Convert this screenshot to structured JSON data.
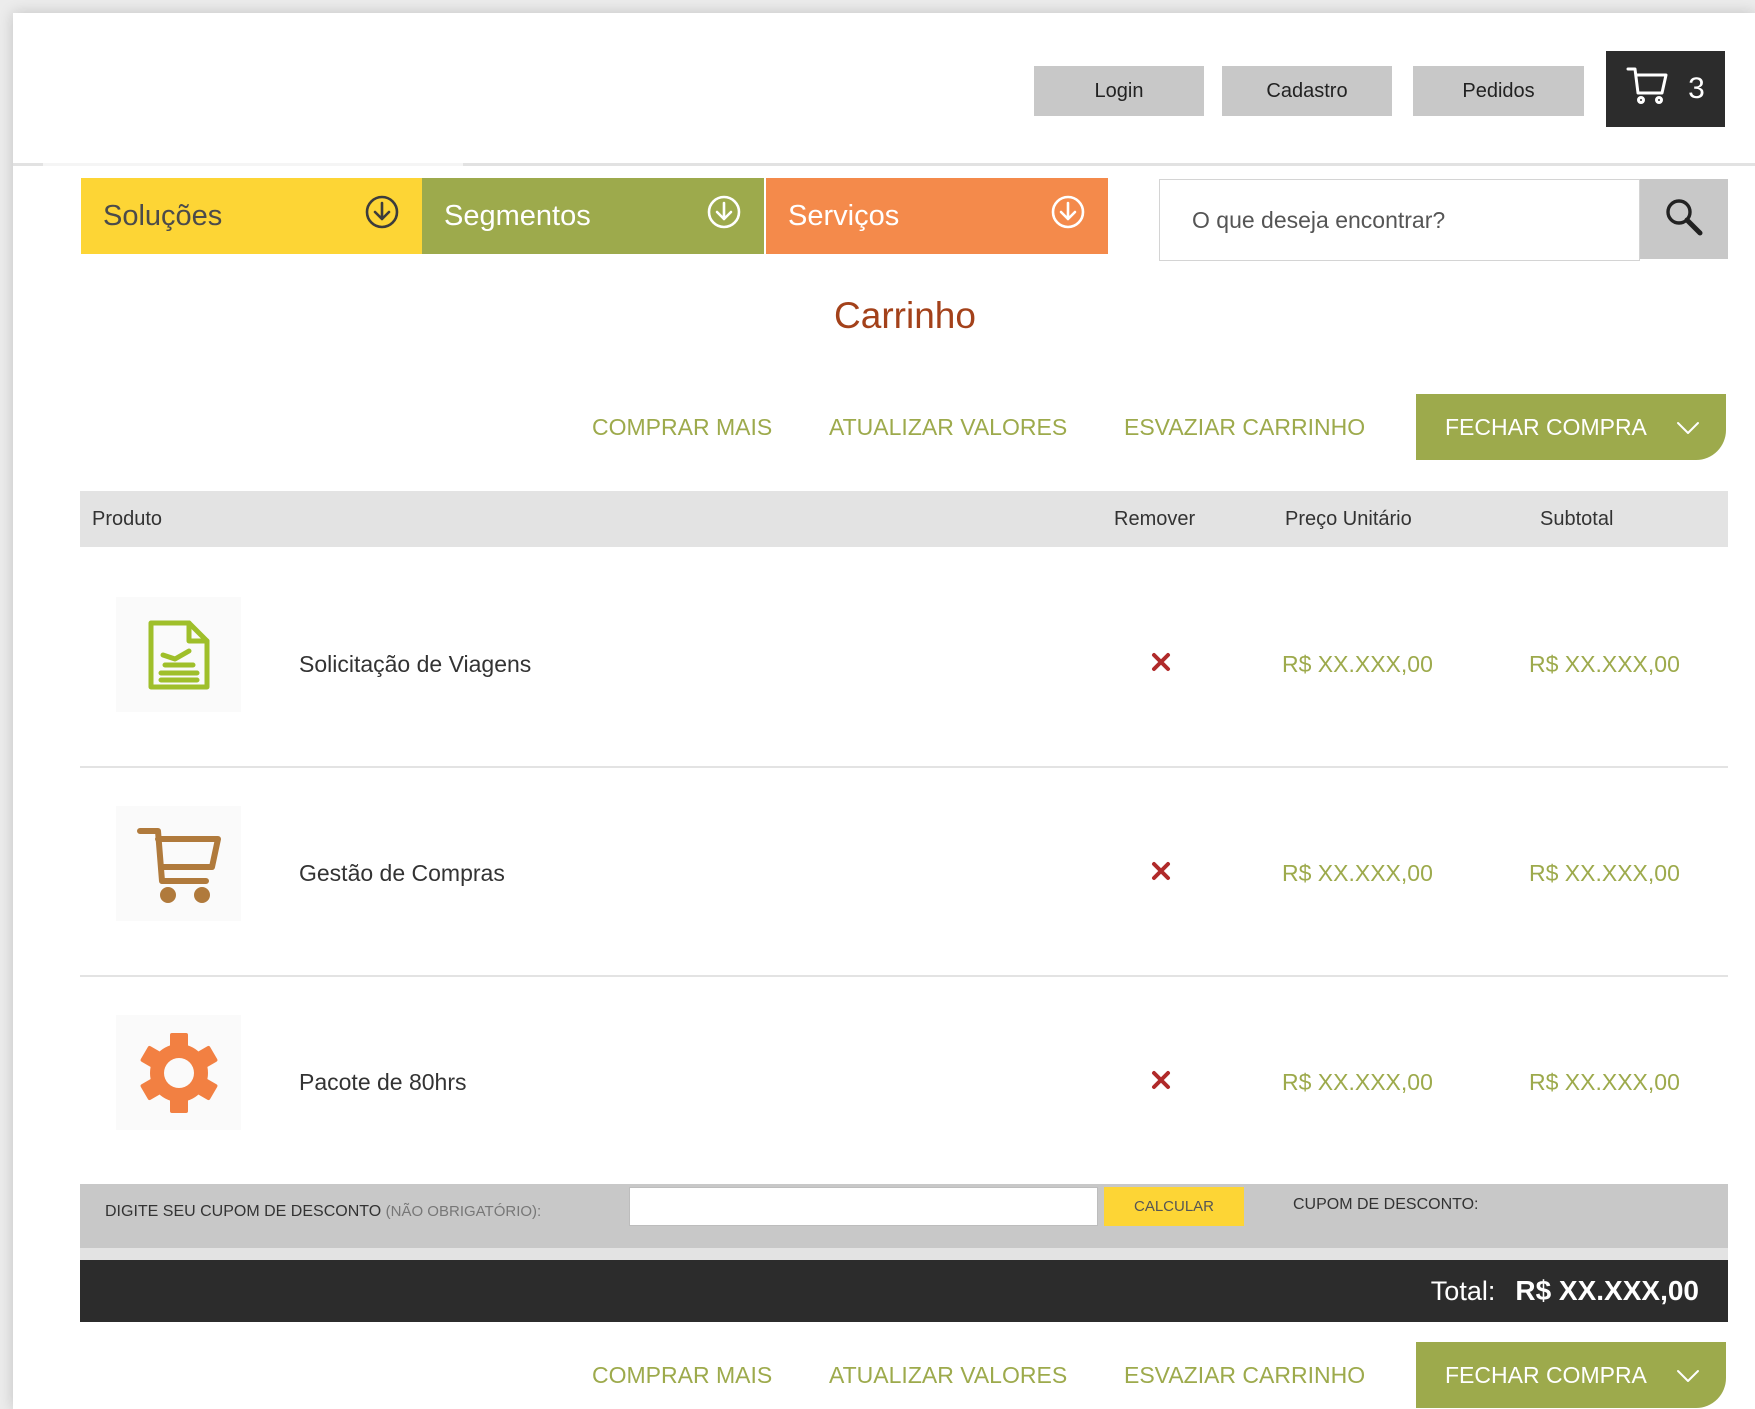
{
  "header": {
    "buttons": {
      "login": "Login",
      "cadastro": "Cadastro",
      "pedidos": "Pedidos"
    },
    "cart_count": "3"
  },
  "nav": {
    "tabs": [
      {
        "label": "Soluções",
        "color": "#fdd535"
      },
      {
        "label": "Segmentos",
        "color": "#9daa4c"
      },
      {
        "label": "Serviços",
        "color": "#f48a4b"
      }
    ],
    "search_placeholder": "O que deseja encontrar?"
  },
  "page_title": "Carrinho",
  "actions": {
    "comprar_mais": "COMPRAR MAIS",
    "atualizar_valores": "ATUALIZAR VALORES",
    "esvaziar_carrinho": "ESVAZIAR CARRINHO",
    "fechar_compra": "FECHAR COMPRA"
  },
  "table": {
    "headers": {
      "produto": "Produto",
      "remover": "Remover",
      "preco_unitario": "Preço Unitário",
      "subtotal": "Subtotal"
    },
    "rows": [
      {
        "name": "Solicitação de Viagens",
        "icon": "travel-document-icon",
        "unit_price": "R$ XX.XXX,00",
        "subtotal": "R$ XX.XXX,00"
      },
      {
        "name": "Gestão de Compras",
        "icon": "shopping-cart-icon",
        "unit_price": "R$ XX.XXX,00",
        "subtotal": "R$ XX.XXX,00"
      },
      {
        "name": "Pacote de 80hrs",
        "icon": "gear-icon",
        "unit_price": "R$ XX.XXX,00",
        "subtotal": "R$ XX.XXX,00"
      }
    ]
  },
  "coupon": {
    "label": "DIGITE SEU CUPOM DE DESCONTO",
    "optional": "(NÃO OBRIGATÓRIO):",
    "button": "CALCULAR",
    "value_label": "CUPOM DE DESCONTO:"
  },
  "total": {
    "label": "Total:",
    "value": "R$ XX.XXX,00"
  },
  "colors": {
    "accent_green": "#9daa4c",
    "accent_yellow": "#fdd535",
    "accent_orange": "#f48a4b",
    "title_brown": "#a3411a",
    "remove_red": "#b02a2a",
    "dark": "#2c2c2c"
  }
}
